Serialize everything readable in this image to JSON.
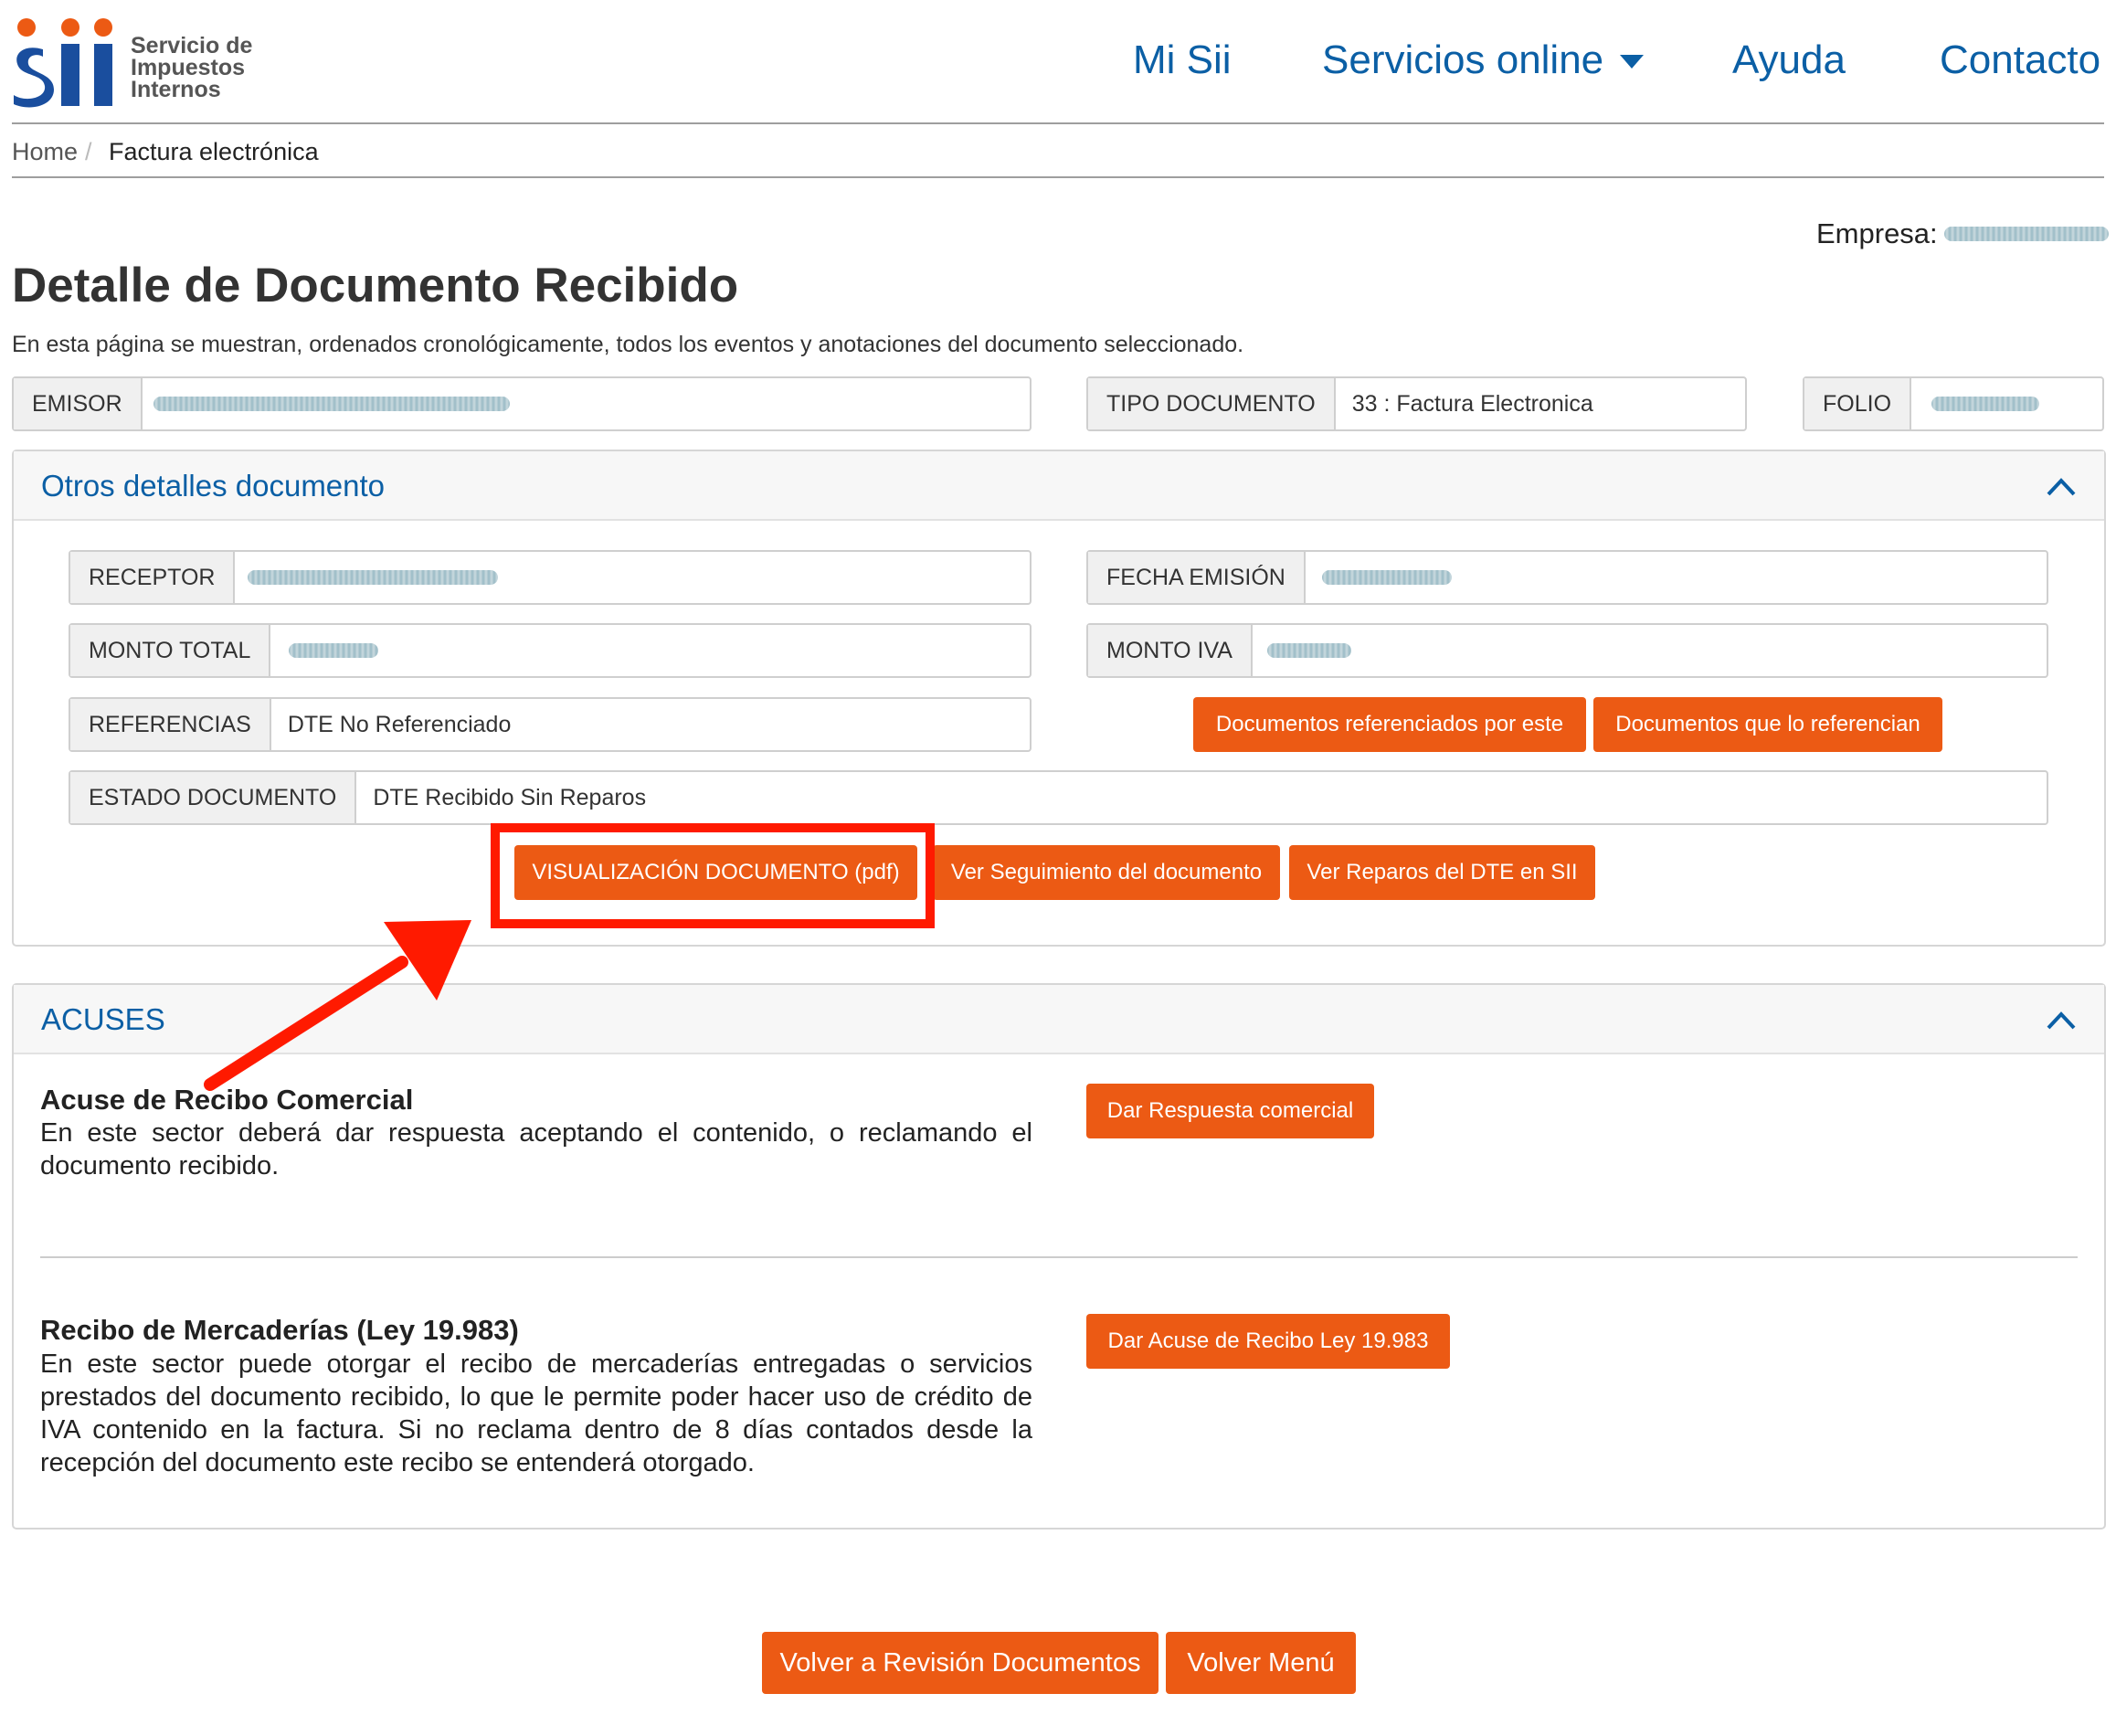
{
  "header": {
    "logo": {
      "mark": "Sii",
      "line1": "Servicio de",
      "line2": "Impuestos",
      "line3": "Internos"
    },
    "nav": [
      "Mi Sii",
      "Servicios online",
      "Ayuda",
      "Contacto"
    ]
  },
  "breadcrumb": {
    "home": "Home",
    "separator": "/",
    "current": "Factura electrónica"
  },
  "empresa_label": "Empresa:",
  "title": "Detalle de Documento Recibido",
  "intro": "En esta página se muestran, ordenados cronológicamente, todos los eventos y anotaciones del documento seleccionado.",
  "top_fields": {
    "emisor": {
      "label": "EMISOR"
    },
    "tipo": {
      "label": "TIPO DOCUMENTO",
      "value": "33 : Factura Electronica"
    },
    "folio": {
      "label": "FOLIO"
    }
  },
  "otros": {
    "title": "Otros detalles documento",
    "receptor": {
      "label": "RECEPTOR"
    },
    "fecha": {
      "label": "FECHA EMISIÓN"
    },
    "monto_total": {
      "label": "MONTO TOTAL"
    },
    "monto_iva": {
      "label": "MONTO IVA"
    },
    "referencias": {
      "label": "REFERENCIAS",
      "value": "DTE No Referenciado"
    },
    "estado": {
      "label": "ESTADO DOCUMENTO",
      "value": "DTE Recibido Sin Reparos"
    },
    "buttons": {
      "ref_por_este": "Documentos referenciados por este",
      "lo_referencian": "Documentos que lo referencian",
      "visualizacion": "VISUALIZACIÓN DOCUMENTO (pdf)",
      "seguimiento": "Ver Seguimiento del documento",
      "reparos": "Ver Reparos del DTE en SII"
    }
  },
  "acuses": {
    "title": "ACUSES",
    "comercial": {
      "title": "Acuse de Recibo Comercial",
      "text": "En este sector deberá dar respuesta aceptando el contenido, o reclamando el documento recibido.",
      "button": "Dar Respuesta comercial"
    },
    "mercaderias": {
      "title": "Recibo de Mercaderías (Ley 19.983)",
      "text": "En este sector puede otorgar el recibo de mercaderías entregadas o servicios prestados del documento recibido, lo que le permite poder hacer uso de crédito de IVA contenido en la factura. Si no reclama dentro de 8 días contados desde la recepción del documento este recibo se entenderá otorgado.",
      "button": "Dar Acuse de Recibo Ley 19.983"
    }
  },
  "footer_buttons": {
    "volver_revision": "Volver a Revisión Documentos",
    "volver_menu": "Volver Menú"
  },
  "colors": {
    "brand_blue": "#0b5fa5",
    "button_orange": "#ec5a14",
    "highlight_red": "#ff1a00"
  },
  "icons": {
    "dropdown": "caret-down-icon",
    "collapse": "chevron-up-icon",
    "annotation": "arrow-annotation"
  }
}
